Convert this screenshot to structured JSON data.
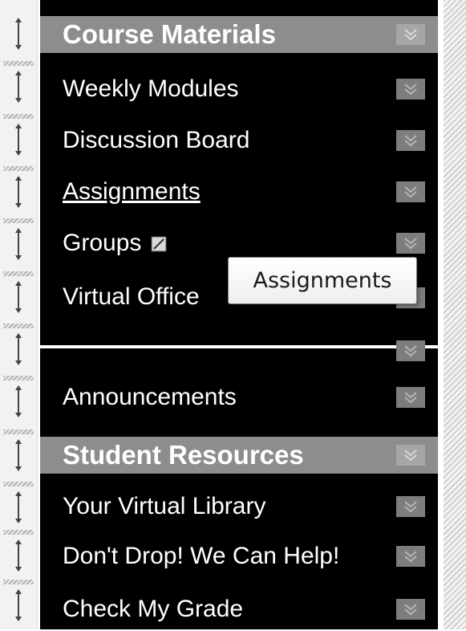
{
  "menu": {
    "items": [
      {
        "label": "Course Materials",
        "kind": "header"
      },
      {
        "label": "Weekly Modules",
        "kind": "item"
      },
      {
        "label": "Discussion Board",
        "kind": "item"
      },
      {
        "label": "Assignments",
        "kind": "item",
        "hovered": true
      },
      {
        "label": "Groups",
        "kind": "item",
        "has_external_icon": true
      },
      {
        "label": "Virtual Office",
        "kind": "item"
      },
      {
        "label": "",
        "kind": "divider"
      },
      {
        "label": "Announcements",
        "kind": "item"
      },
      {
        "label": "Student Resources",
        "kind": "header"
      },
      {
        "label": "Your Virtual Library",
        "kind": "item"
      },
      {
        "label": "Don't Drop! We Can Help!",
        "kind": "item"
      },
      {
        "label": "Check My Grade",
        "kind": "item"
      }
    ]
  },
  "tooltip": {
    "text": "Assignments"
  },
  "icons": {
    "handle": "drag-handle-icon",
    "chevron": "chevron-down-icon",
    "external": "external-link-icon"
  },
  "colors": {
    "panel": "#000000",
    "header": "#8d8d8d",
    "text": "#ffffff",
    "chevron_box": "#7d7d7d"
  }
}
